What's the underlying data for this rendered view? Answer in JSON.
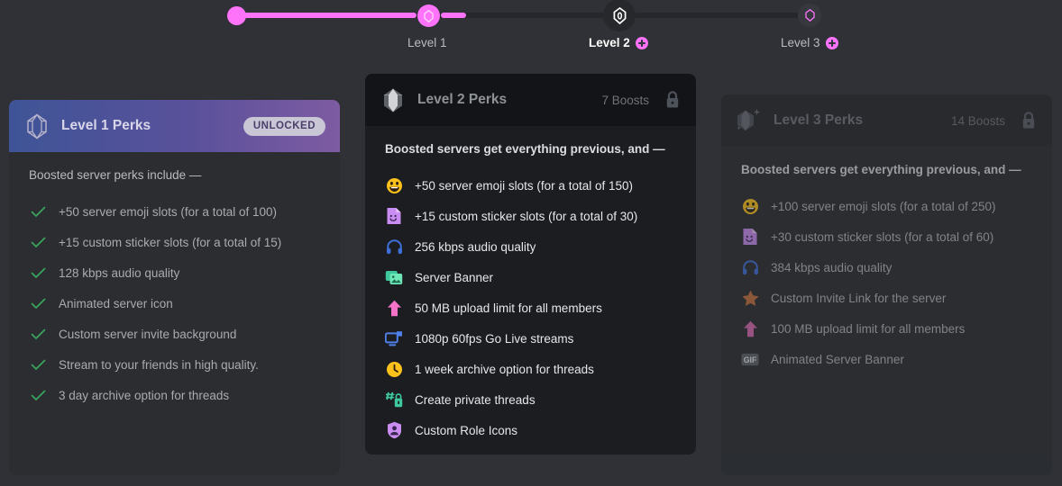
{
  "progress": {
    "levels": [
      {
        "label": "Level 1",
        "state": "reached",
        "has_plus": false
      },
      {
        "label": "Level 2",
        "state": "current",
        "has_plus": true
      },
      {
        "label": "Level 3",
        "state": "locked",
        "has_plus": true
      }
    ],
    "fill_color": "#ff73fa",
    "track_color": "#26272b"
  },
  "cards": [
    {
      "title": "Level 1 Perks",
      "badge": "UNLOCKED",
      "intro": "Boosted server perks include —",
      "state": "unlocked",
      "perks": [
        {
          "icon": "check-icon",
          "text": "+50 server emoji slots (for a total of 100)"
        },
        {
          "icon": "check-icon",
          "text": "+15 custom sticker slots (for a total of 15)"
        },
        {
          "icon": "check-icon",
          "text": "128 kbps audio quality"
        },
        {
          "icon": "check-icon",
          "text": "Animated server icon"
        },
        {
          "icon": "check-icon",
          "text": "Custom server invite background"
        },
        {
          "icon": "check-icon",
          "text": "Stream to your friends in high quality."
        },
        {
          "icon": "check-icon",
          "text": "3 day archive option for threads"
        }
      ]
    },
    {
      "title": "Level 2 Perks",
      "badge": "7 Boosts",
      "intro": "Boosted servers get everything previous, and —",
      "state": "locked",
      "perks": [
        {
          "icon": "emoji-icon",
          "text": "+50 server emoji slots (for a total of 150)"
        },
        {
          "icon": "sticker-icon",
          "text": "+15 custom sticker slots (for a total of 30)"
        },
        {
          "icon": "headphones-icon",
          "text": "256 kbps audio quality"
        },
        {
          "icon": "banner-icon",
          "text": "Server Banner"
        },
        {
          "icon": "upload-icon",
          "text": "50 MB upload limit for all members"
        },
        {
          "icon": "screen-icon",
          "text": "1080p 60fps Go Live streams"
        },
        {
          "icon": "clock-icon",
          "text": "1 week archive option for threads"
        },
        {
          "icon": "private-thread-icon",
          "text": "Create private threads"
        },
        {
          "icon": "shield-person-icon",
          "text": "Custom Role Icons"
        }
      ]
    },
    {
      "title": "Level 3 Perks",
      "badge": "14 Boosts",
      "intro": "Boosted servers get everything previous, and —",
      "state": "locked",
      "perks": [
        {
          "icon": "emoji-icon",
          "text": "+100 server emoji slots (for a total of 250)"
        },
        {
          "icon": "sticker-icon",
          "text": "+30 custom sticker slots (for a total of 60)"
        },
        {
          "icon": "headphones-icon",
          "text": "384 kbps audio quality"
        },
        {
          "icon": "star-icon",
          "text": "Custom Invite Link for the server"
        },
        {
          "icon": "upload-icon",
          "text": "100 MB upload limit for all members"
        },
        {
          "icon": "gif-icon",
          "text": "Animated Server Banner"
        }
      ]
    }
  ]
}
